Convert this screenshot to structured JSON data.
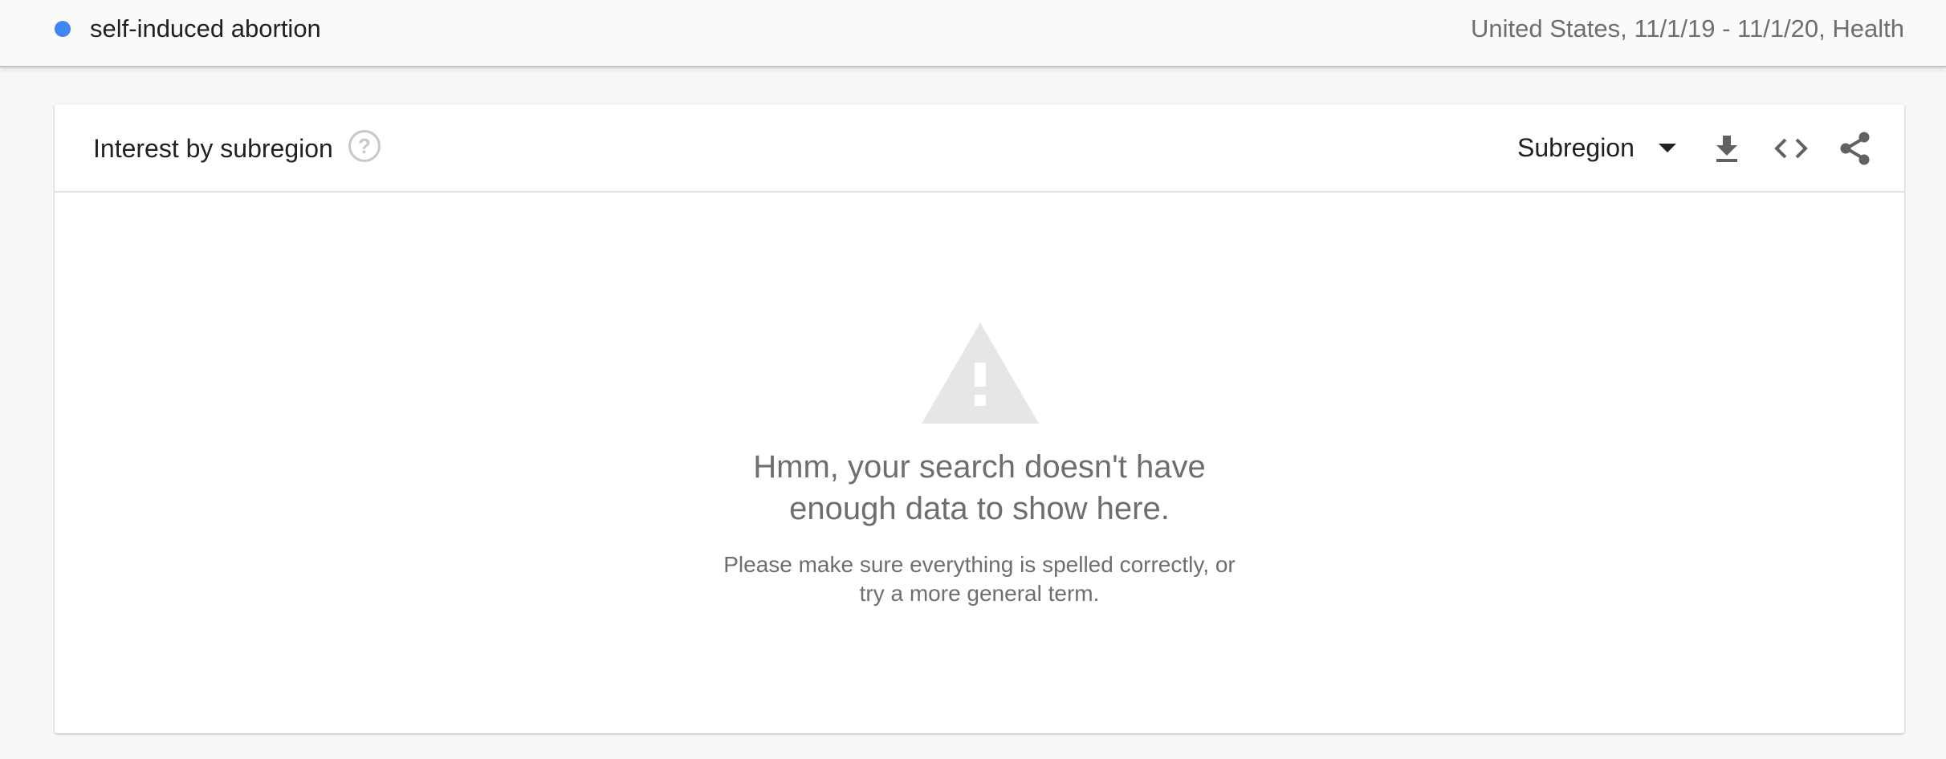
{
  "term_bar": {
    "term": "self-induced abortion",
    "term_color": "#4285f4",
    "meta": "United States, 11/1/19 - 11/1/20, Health"
  },
  "widget": {
    "title": "Interest by subregion",
    "help_icon": "help-circle-icon",
    "resolution_select": {
      "selected": "Subregion"
    },
    "actions": [
      {
        "name": "download-icon"
      },
      {
        "name": "embed-code-icon"
      },
      {
        "name": "share-icon"
      }
    ]
  },
  "empty_state": {
    "icon": "warning-icon",
    "message_line1": "Hmm, your search doesn't have",
    "message_line2": "enough data to show here.",
    "hint_line1": "Please make sure everything is spelled correctly, or",
    "hint_line2": "try a more general term."
  }
}
